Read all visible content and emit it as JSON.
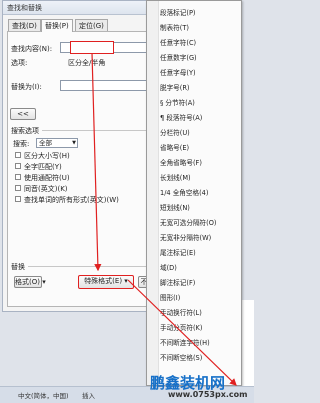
{
  "dialog": {
    "title": "查找和替换",
    "tabs": [
      "查找(D)",
      "替换(P)",
      "定位(G)"
    ],
    "find_label": "查找内容(N):",
    "find_value": "",
    "options_label": "选项:",
    "options_value": "区分全/半角",
    "replace_label": "替换为(I):",
    "replace_value": "",
    "less_button": "<<",
    "search_options_heading": "搜索选项",
    "search_label": "搜索:",
    "search_value": "全部",
    "checkboxes": [
      "区分大小写(H)",
      "全字匹配(Y)",
      "使用通配符(U)",
      "同音(英文)(K)",
      "查找单词的所有形式(英文)(W)"
    ],
    "replace_heading": "替换",
    "format_button": "格式(O) ▾",
    "special_button": "特殊格式(E) ▾",
    "no_format_button": "不"
  },
  "menu": {
    "items": [
      "段落标记(P)",
      "制表符(T)",
      "任意字符(C)",
      "任意数字(G)",
      "任意字母(Y)",
      "脱字号(R)",
      "§ 分节符(A)",
      "¶ 段落符号(A)",
      "分栏符(U)",
      "省略号(E)",
      "全角省略号(F)",
      "长划线(M)",
      "1/4 全角空格(4)",
      "短划线(N)",
      "无宽可选分隔符(O)",
      "无宽非分隔符(W)",
      "尾注标记(E)",
      "域(D)",
      "脚注标记(F)",
      "图形(I)",
      "手动换行符(L)",
      "手动分页符(K)",
      "不间断连字符(H)",
      "不间断空格(S)"
    ]
  },
  "status": {
    "language": "中文(简体，中国)",
    "mode": "插入"
  },
  "watermark": {
    "brand": "鹏鑫装机网",
    "url": "www.0753px.com"
  },
  "colors": {
    "highlight": "#e02020",
    "brand_blue": "#1670c8"
  }
}
